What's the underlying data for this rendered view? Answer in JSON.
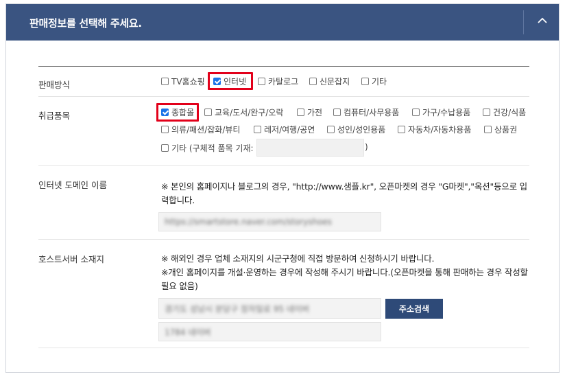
{
  "header": {
    "title": "판매정보를 선택해 주세요."
  },
  "sales_method": {
    "label": "판매방식",
    "options": [
      {
        "label": "TV홈쇼핑",
        "checked": false
      },
      {
        "label": "인터넷",
        "checked": true,
        "highlighted": true
      },
      {
        "label": "카탈로그",
        "checked": false
      },
      {
        "label": "신문잡지",
        "checked": false
      },
      {
        "label": "기타",
        "checked": false
      }
    ]
  },
  "product_types": {
    "label": "취급품목",
    "options": [
      {
        "label": "종합몰",
        "checked": true,
        "highlighted": true
      },
      {
        "label": "교육/도서/완구/오락",
        "checked": false
      },
      {
        "label": "가전",
        "checked": false
      },
      {
        "label": "컴퓨터/사무용품",
        "checked": false
      },
      {
        "label": "가구/수납용품",
        "checked": false
      },
      {
        "label": "건강/식품",
        "checked": false
      },
      {
        "label": "의류/패션/잡화/뷰티",
        "checked": false
      },
      {
        "label": "레저/여행/공연",
        "checked": false
      },
      {
        "label": "성인/성인용품",
        "checked": false
      },
      {
        "label": "자동차/자동차용품",
        "checked": false
      },
      {
        "label": "상품권",
        "checked": false
      },
      {
        "label": "기타 (구체적 품목 기재:",
        "checked": false
      }
    ],
    "etc_value": "",
    "close_paren": ")"
  },
  "domain": {
    "label": "인터넷 도메인 이름",
    "note": "※ 본인의 홈페이지나 블로그의 경우, \"http://www.샘플.kr\", 오픈마켓의 경우 \"G마켓\",\"옥션\"등으로 입력합니다.",
    "value": "https://smartstore.naver.com/storyshoes"
  },
  "host": {
    "label": "호스트서버 소재지",
    "note1": "※ 해외인 경우 업체 소재지의 시군구청에 직접 방문하여 신청하시기 바랍니다.",
    "note2": "※개인 홈페이지를 개설·운영하는 경우에 작성해 주시기 바랍니다.(오픈마켓을 통해 판매하는 경우 작성할 필요 없음)",
    "address1": "경기도 성남시 분당구 정자일로 95 네이버",
    "address2": "1784 네이버",
    "search_button": "주소검색"
  },
  "colors": {
    "header_bg": "#3a5481",
    "highlight": "#e2001a",
    "button_bg": "#2e4a78",
    "checkbox_checked": "#1a73e8"
  }
}
